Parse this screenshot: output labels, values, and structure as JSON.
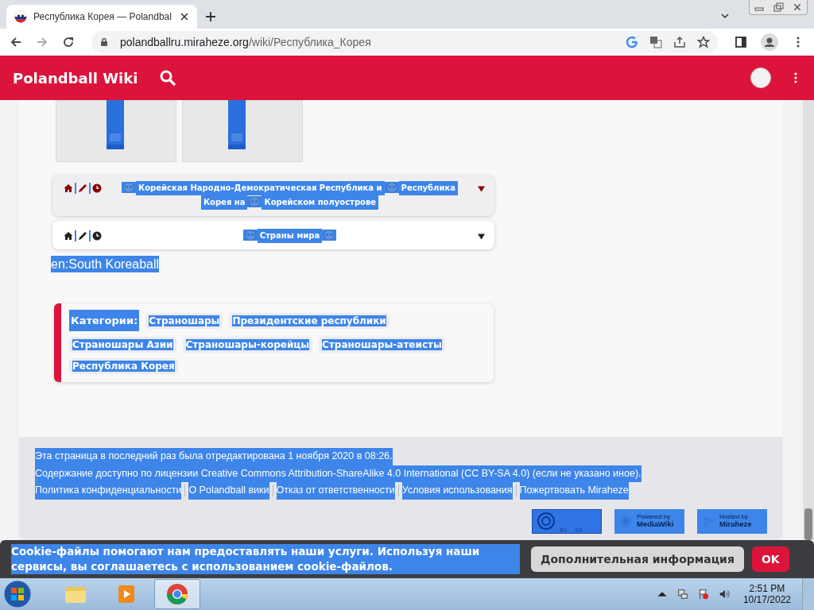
{
  "browser": {
    "tab_title": "Республика Корея — Polandbal",
    "url_host": "polandballru.miraheze.org",
    "url_path": "/wiki/Республика_Корея"
  },
  "header": {
    "title": "Polandball Wiki"
  },
  "text_selected": true,
  "navboxes": [
    {
      "color": "#8b0000",
      "title": [
        {
          "kind": "flag"
        },
        {
          "kind": "text",
          "text": "Корейская Народно-Демократическая Республика и"
        },
        {
          "kind": "flag"
        },
        {
          "kind": "text",
          "text": "Республика"
        },
        {
          "kind": "text",
          "text": "Корея на"
        },
        {
          "kind": "flag"
        },
        {
          "kind": "text",
          "text": "Корейском полуострове"
        }
      ]
    },
    {
      "color": "#222222",
      "title": [
        {
          "kind": "flag"
        },
        {
          "kind": "text",
          "text": "Страны мира"
        },
        {
          "kind": "flag"
        }
      ]
    }
  ],
  "interwiki": "en:South Koreaball",
  "categories": {
    "label": "Категории:",
    "items": [
      "Страношары",
      "Президентские республики",
      "Страношары Азии",
      "Страношары-корейцы",
      "Страношары-атеисты",
      "Республика Корея"
    ]
  },
  "footer": {
    "lines": [
      "Эта страница в последний раз была отредактирована 1 ноября 2020 в 08:26.",
      "Содержание доступно по лицензии Creative Commons Attribution-ShareAlike 4.0 International (CC BY-SA 4.0) (если не указано иное)."
    ],
    "links": [
      "Политика конфиденциальности",
      "О Polandball вики",
      "Отказ от ответственности",
      "Условия использования",
      "Пожертвовать Miraheze"
    ],
    "badges": {
      "cc": [
        "BY",
        "SA"
      ],
      "mediawiki": [
        "Powered by",
        "MediaWiki"
      ],
      "miraheze": [
        "Hosted by",
        "Miraheze"
      ]
    }
  },
  "cookie": {
    "text": "Cookie-файлы помогают нам предоставлять наши услуги. Используя наши сервисы, вы соглашаетесь с использованием cookie-файлов.",
    "more_button": "Дополнительная информация",
    "ok_button": "OK"
  },
  "taskbar": {
    "time": "2:51 PM",
    "date": "10/17/2022"
  }
}
